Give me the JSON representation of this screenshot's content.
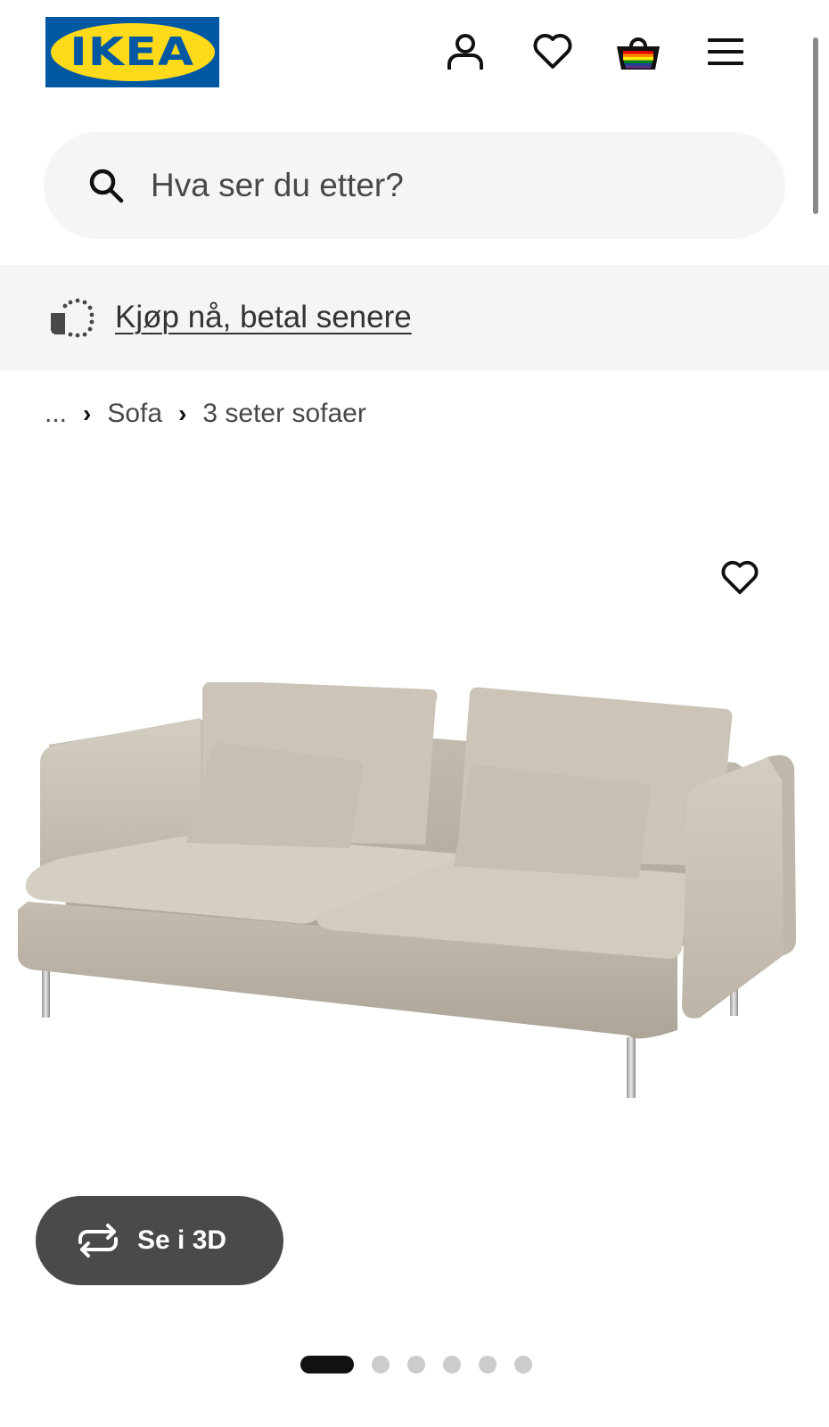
{
  "header": {
    "logo_text": "IKEA",
    "icons": [
      "profile-icon",
      "heart-icon",
      "basket-icon",
      "menu-icon"
    ]
  },
  "search": {
    "placeholder": "Hva ser du etter?"
  },
  "banner": {
    "link_text": "Kjøp nå, betal senere"
  },
  "breadcrumb": {
    "ellipsis": "...",
    "items": [
      "Sofa",
      "3 seter sofaer"
    ]
  },
  "product": {
    "image_alt": "sofa-image",
    "view_3d_label": "Se i 3D",
    "carousel": {
      "total": 6,
      "active": 1
    }
  },
  "colors": {
    "ikea_blue": "#0058a3",
    "ikea_yellow": "#ffda1a",
    "sofa_fabric": "#c9c2b4"
  }
}
